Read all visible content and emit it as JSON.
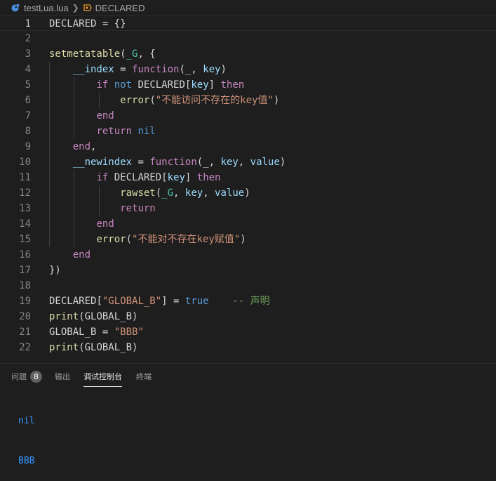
{
  "breadcrumb": {
    "file": "testLua.lua",
    "symbol": "DECLARED"
  },
  "code_lines": [
    "DECLARED = {}",
    "",
    "setmetatable(_G, {",
    "    __index = function(_, key)",
    "        if not DECLARED[key] then",
    "            error(\"不能访问不存在的key值\")",
    "        end",
    "        return nil",
    "    end,",
    "    __newindex = function(_, key, value)",
    "        if DECLARED[key] then",
    "            rawset(_G, key, value)",
    "            return",
    "        end",
    "        error(\"不能对不存在key赋值\")",
    "    end",
    "})",
    "",
    "DECLARED[\"GLOBAL_B\"] = true    -- 声明",
    "print(GLOBAL_B)",
    "GLOBAL_B = \"BBB\"",
    "print(GLOBAL_B)"
  ],
  "line_numbers": [
    "1",
    "2",
    "3",
    "4",
    "5",
    "6",
    "7",
    "8",
    "9",
    "10",
    "11",
    "12",
    "13",
    "14",
    "15",
    "16",
    "17",
    "18",
    "19",
    "20",
    "21",
    "22"
  ],
  "panel": {
    "tabs": [
      {
        "label": "问题",
        "badge": "8"
      },
      {
        "label": "输出"
      },
      {
        "label": "调试控制台"
      },
      {
        "label": "终端"
      }
    ],
    "active_tab": "调试控制台",
    "console_output": [
      "nil",
      "BBB"
    ]
  },
  "colors": {
    "editor_bg": "#1e1e1e",
    "keyword": "#c586c0",
    "constant": "#569cd6",
    "function": "#dcdcaa",
    "variable": "#9cdcfe",
    "string": "#ce9178",
    "comment": "#6a9955",
    "console_text": "#3794ff"
  },
  "icons": {
    "file_icon": "lua-file-icon",
    "symbol_icon": "symbol-variable-icon"
  }
}
